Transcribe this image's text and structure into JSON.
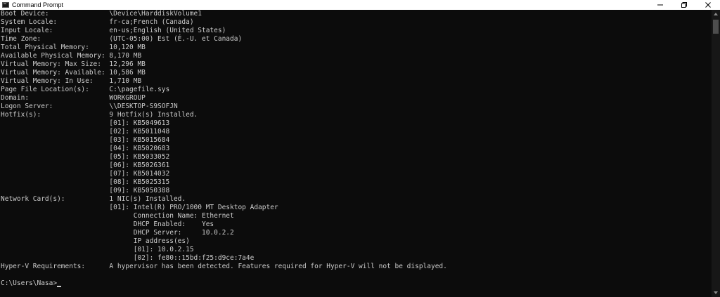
{
  "window": {
    "title": "Command Prompt",
    "icon": "cmd-icon",
    "buttons": [
      "minimize-icon",
      "maximize-icon",
      "close-icon"
    ]
  },
  "console": {
    "lines": [
      "Boot Device:               \\Device\\HarddiskVolume1",
      "System Locale:             fr-ca;French (Canada)",
      "Input Locale:              en-us;English (United States)",
      "Time Zone:                 (UTC-05:00) Est (É.-U. et Canada)",
      "Total Physical Memory:     10,120 MB",
      "Available Physical Memory: 8,170 MB",
      "Virtual Memory: Max Size:  12,296 MB",
      "Virtual Memory: Available: 10,586 MB",
      "Virtual Memory: In Use:    1,710 MB",
      "Page File Location(s):     C:\\pagefile.sys",
      "Domain:                    WORKGROUP",
      "Logon Server:              \\\\DESKTOP-S9SOFJN",
      "Hotfix(s):                 9 Hotfix(s) Installed.",
      "                           [01]: KB5049613",
      "                           [02]: KB5011048",
      "                           [03]: KB5015684",
      "                           [04]: KB5020683",
      "                           [05]: KB5033052",
      "                           [06]: KB5026361",
      "                           [07]: KB5014032",
      "                           [08]: KB5025315",
      "                           [09]: KB5050388",
      "Network Card(s):           1 NIC(s) Installed.",
      "                           [01]: Intel(R) PRO/1000 MT Desktop Adapter",
      "                                 Connection Name: Ethernet",
      "                                 DHCP Enabled:    Yes",
      "                                 DHCP Server:     10.0.2.2",
      "                                 IP address(es)",
      "                                 [01]: 10.0.2.15",
      "                                 [02]: fe80::15bd:f25:d9ce:7a4e",
      "Hyper-V Requirements:      A hypervisor has been detected. Features required for Hyper-V will not be displayed.",
      ""
    ],
    "prompt": "C:\\Users\\Nasa>"
  },
  "colors": {
    "background": "#0c0c0c",
    "text": "#cccccc",
    "titlebar": "#ffffff"
  }
}
